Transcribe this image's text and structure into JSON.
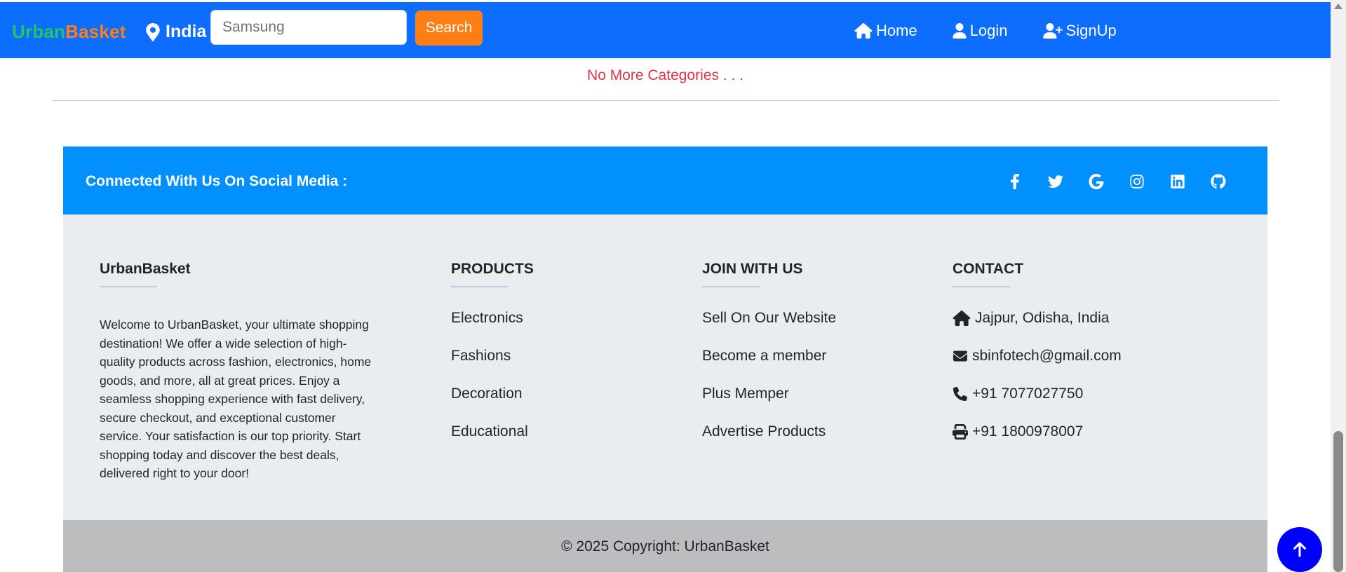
{
  "navbar": {
    "brand_part1": "Urban",
    "brand_part2": "Basket",
    "location": "India",
    "search_value": "Samsung",
    "search_placeholder": "Search",
    "search_button": "Search",
    "links": {
      "home": "Home",
      "login": "Login",
      "signup": "SignUp"
    }
  },
  "status_message": "No More Categories . . .",
  "social": {
    "title": "Connected With Us On Social Media :",
    "icons": [
      "facebook-icon",
      "twitter-icon",
      "google-icon",
      "instagram-icon",
      "linkedin-icon",
      "github-icon"
    ]
  },
  "footer": {
    "about": {
      "heading": "UrbanBasket",
      "text": "Welcome to UrbanBasket, your ultimate shopping destination! We offer a wide selection of high-quality products across fashion, electronics, home goods, and more, all at great prices. Enjoy a seamless shopping experience with fast delivery, secure checkout, and exceptional customer service. Your satisfaction is our top priority. Start shopping today and discover the best deals, delivered right to your door!"
    },
    "products": {
      "heading": "PRODUCTS",
      "items": [
        "Electronics",
        "Fashions",
        "Decoration",
        "Educational"
      ]
    },
    "join": {
      "heading": "JOIN WITH US",
      "items": [
        "Sell On Our Website",
        "Become a member",
        "Plus Memper",
        "Advertise Products"
      ]
    },
    "contact": {
      "heading": "CONTACT",
      "address": "Jajpur, Odisha, India",
      "email": "sbinfotech@gmail.com",
      "phone": "+91 7077027750",
      "fax": "+91 1800978007"
    },
    "copyright": "© 2025 Copyright: UrbanBasket"
  },
  "colors": {
    "navbar": "#0d6efd",
    "brand_green": "#22c55e",
    "brand_orange": "#fd7e14",
    "social_strip": "#0290ff",
    "footer_bg": "#eaedf0",
    "copyright_bg": "#bcbdbf",
    "alert_red": "#dc3545",
    "to_top": "#0000ff"
  }
}
